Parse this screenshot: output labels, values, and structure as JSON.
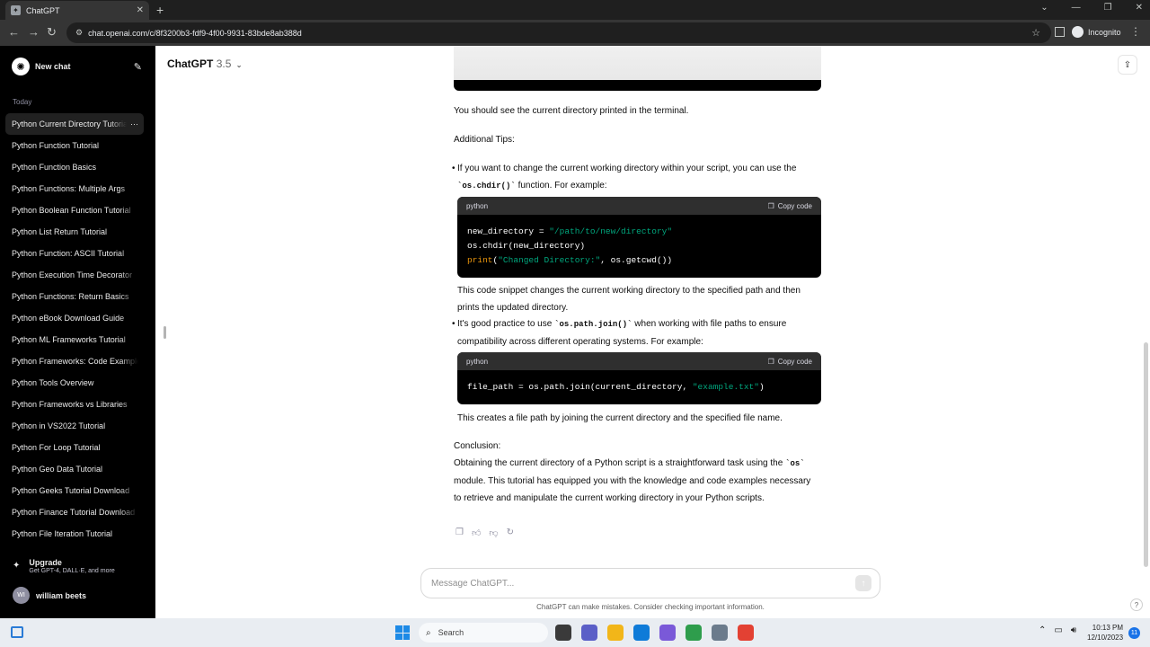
{
  "browser": {
    "tab_title": "ChatGPT",
    "url": "chat.openai.com/c/8f3200b3-fdf9-4f00-9931-83bde8ab388d",
    "incognito_label": "Incognito"
  },
  "sidebar": {
    "new_chat_label": "New chat",
    "section_label": "Today",
    "items": [
      "Python Current Directory Tutorial",
      "Python Function Tutorial",
      "Python Function Basics",
      "Python Functions: Multiple Args",
      "Python Boolean Function Tutorial",
      "Python List Return Tutorial",
      "Python Function: ASCII Tutorial",
      "Python Execution Time Decorator",
      "Python Functions: Return Basics",
      "Python eBook Download Guide",
      "Python ML Frameworks Tutorial",
      "Python Frameworks: Code Examples",
      "Python Tools Overview",
      "Python Frameworks vs Libraries",
      "Python in VS2022 Tutorial",
      "Python For Loop Tutorial",
      "Python Geo Data Tutorial",
      "Python Geeks Tutorial Download",
      "Python Finance Tutorial Download",
      "Python File Iteration Tutorial"
    ],
    "active_item_menu": "···",
    "upgrade_title": "Upgrade",
    "upgrade_subtitle": "Get GPT-4, DALL·E, and more",
    "user_initials": "WI",
    "user_name": "william beets"
  },
  "header": {
    "model_name": "ChatGPT",
    "model_version": "3.5"
  },
  "message": {
    "p1": "You should see the current directory printed in the terminal.",
    "p2": "Additional Tips:",
    "b1_pre": "If you want to change the current working directory within your script, you can use the",
    "b1_code": "`os.chdir()`",
    "b1_post": "function. For example:",
    "code1_lang": "python",
    "code1_l1_a": "new_directory = ",
    "code1_l1_b": "\"/path/to/new/directory\"",
    "code1_l2": "os.chdir(new_directory)",
    "code1_l3_a": "print",
    "code1_l3_b": "(",
    "code1_l3_c": "\"Changed Directory:\"",
    "code1_l3_d": ", os.getcwd())",
    "b1_after": "This code snippet changes the current working directory to the specified path and then prints the updated directory.",
    "b2_pre": "It's good practice to use",
    "b2_code": "`os.path.join()`",
    "b2_post": "when working with file paths to ensure compatibility across different operating systems. For example:",
    "code2_lang": "python",
    "code2_a": "file_path = os.path.join(current_directory, ",
    "code2_b": "\"example.txt\"",
    "code2_c": ")",
    "b2_after": "This creates a file path by joining the current directory and the specified file name.",
    "conclusion_label": "Conclusion:",
    "conclusion_pre": "Obtaining the current directory of a Python script is a straightforward task using the",
    "conclusion_code": "`os`",
    "conclusion_post": "module. This tutorial has equipped you with the knowledge and code examples necessary to retrieve and manipulate the current working directory in your Python scripts."
  },
  "copy_code_label": "Copy code",
  "composer": {
    "placeholder": "Message ChatGPT...",
    "disclaimer": "ChatGPT can make mistakes. Consider checking important information."
  },
  "taskbar": {
    "search_label": "Search",
    "time": "10:13 PM",
    "date": "12/10/2023",
    "notification_count": "11",
    "icon_colors": [
      "#3a3a3a",
      "#5b5fc7",
      "#f2b619",
      "#0f7bd8",
      "#7a59d8",
      "#2e9d4c",
      "#6b7b8c",
      "#e34133"
    ]
  },
  "help_label": "?"
}
